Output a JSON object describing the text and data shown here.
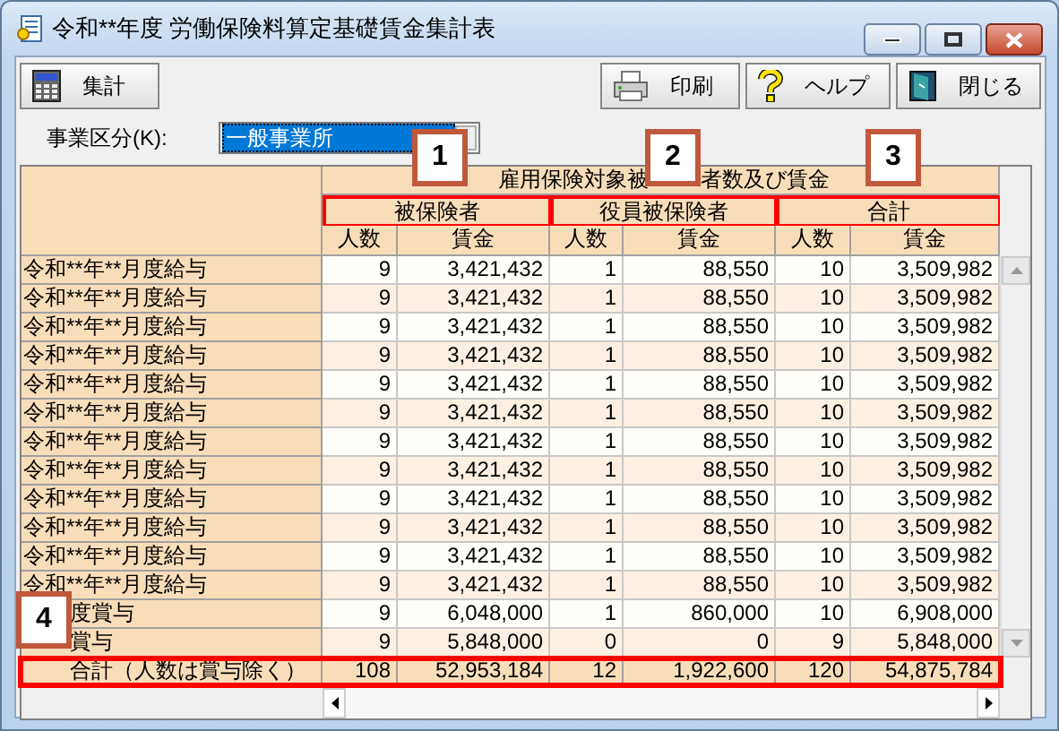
{
  "window": {
    "title": "令和**年度 労働保険料算定基礎賃金集計表"
  },
  "toolbar": [
    {
      "label": "集計",
      "kind": "calculate"
    },
    {
      "label": "印刷",
      "kind": "print"
    },
    {
      "label": "ヘルプ",
      "kind": "help"
    },
    {
      "label": "閉じる",
      "kind": "close"
    }
  ],
  "business_type": {
    "label": "事業区分(K):",
    "value": "一般事業所"
  },
  "table": {
    "header_parts": [
      "雇用保険対象被",
      "者数及び賃金"
    ],
    "groups": [
      {
        "label": "被保険者",
        "highlighted": true
      },
      {
        "label": "役員被保険者",
        "highlighted": true
      },
      {
        "label": "合計",
        "highlighted": true
      }
    ],
    "subcolumns": [
      "人数",
      "賃金",
      "人数",
      "賃金",
      "人数",
      "賃金"
    ],
    "rows": [
      {
        "label": "令和**年**月度給与",
        "kind": "salary",
        "cells": [
          "9",
          "3,421,432",
          "1",
          "88,550",
          "10",
          "3,509,982"
        ]
      },
      {
        "label": "令和**年**月度給与",
        "kind": "salary",
        "cells": [
          "9",
          "3,421,432",
          "1",
          "88,550",
          "10",
          "3,509,982"
        ]
      },
      {
        "label": "令和**年**月度給与",
        "kind": "salary",
        "cells": [
          "9",
          "3,421,432",
          "1",
          "88,550",
          "10",
          "3,509,982"
        ]
      },
      {
        "label": "令和**年**月度給与",
        "kind": "salary",
        "cells": [
          "9",
          "3,421,432",
          "1",
          "88,550",
          "10",
          "3,509,982"
        ]
      },
      {
        "label": "令和**年**月度給与",
        "kind": "salary",
        "cells": [
          "9",
          "3,421,432",
          "1",
          "88,550",
          "10",
          "3,509,982"
        ]
      },
      {
        "label": "令和**年**月度給与",
        "kind": "salary",
        "cells": [
          "9",
          "3,421,432",
          "1",
          "88,550",
          "10",
          "3,509,982"
        ]
      },
      {
        "label": "令和**年**月度給与",
        "kind": "salary",
        "cells": [
          "9",
          "3,421,432",
          "1",
          "88,550",
          "10",
          "3,509,982"
        ]
      },
      {
        "label": "令和**年**月度給与",
        "kind": "salary",
        "cells": [
          "9",
          "3,421,432",
          "1",
          "88,550",
          "10",
          "3,509,982"
        ]
      },
      {
        "label": "令和**年**月度給与",
        "kind": "salary",
        "cells": [
          "9",
          "3,421,432",
          "1",
          "88,550",
          "10",
          "3,509,982"
        ]
      },
      {
        "label": "令和**年**月度給与",
        "kind": "salary",
        "cells": [
          "9",
          "3,421,432",
          "1",
          "88,550",
          "10",
          "3,509,982"
        ]
      },
      {
        "label": "令和**年**月度給与",
        "kind": "salary",
        "cells": [
          "9",
          "3,421,432",
          "1",
          "88,550",
          "10",
          "3,509,982"
        ]
      },
      {
        "label": "令和**年**月度給与",
        "kind": "salary",
        "cells": [
          "9",
          "3,421,432",
          "1",
          "88,550",
          "10",
          "3,509,982"
        ]
      },
      {
        "label": "度賞与",
        "kind": "bonus",
        "cells": [
          "9",
          "6,048,000",
          "1",
          "860,000",
          "10",
          "6,908,000"
        ]
      },
      {
        "label": "賞与",
        "kind": "bonus",
        "cells": [
          "9",
          "5,848,000",
          "0",
          "0",
          "9",
          "5,848,000"
        ]
      }
    ],
    "total": {
      "label": "合計（人数は賞与除く）",
      "highlighted": true,
      "cells": [
        "108",
        "52,953,184",
        "12",
        "1,922,600",
        "120",
        "54,875,784"
      ]
    }
  },
  "callouts": [
    {
      "number": "1"
    },
    {
      "number": "2"
    },
    {
      "number": "3"
    },
    {
      "number": "4"
    }
  ]
}
